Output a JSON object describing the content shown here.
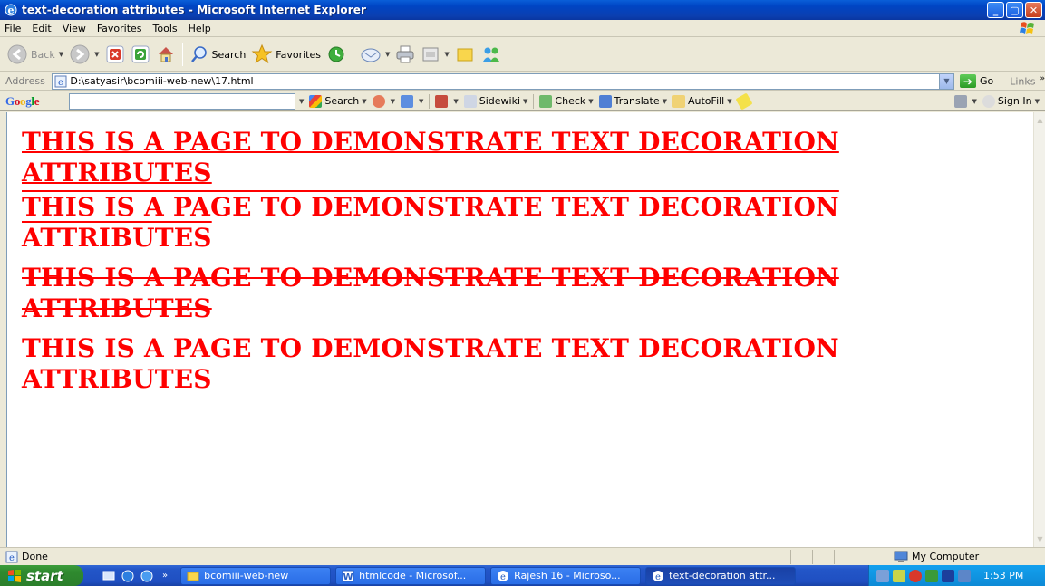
{
  "window": {
    "title": "text-decoration attributes - Microsoft Internet Explorer",
    "buttons": {
      "minimize": "_",
      "maximize": "▢",
      "close": "✕"
    }
  },
  "menu": [
    "File",
    "Edit",
    "View",
    "Favorites",
    "Tools",
    "Help"
  ],
  "toolbar": {
    "back": "Back",
    "search": "Search",
    "favorites": "Favorites"
  },
  "address": {
    "label": "Address",
    "value": "D:\\satyasir\\bcomiii-web-new\\17.html",
    "go": "Go",
    "links": "Links"
  },
  "google": {
    "logo": "Google",
    "search_value": "",
    "items": {
      "search": "Search",
      "sidewiki": "Sidewiki",
      "check": "Check",
      "translate": "Translate",
      "autofill": "AutoFill",
      "sign_in": "Sign In"
    }
  },
  "content": {
    "headings": [
      {
        "text": "THIS IS A PAGE TO DEMONSTRATE TEXT DECORATION ATTRIBUTES",
        "decoration": "underline"
      },
      {
        "text": "THIS IS A PAGE TO DEMONSTRATE TEXT DECORATION ATTRIBUTES",
        "decoration": "overline"
      },
      {
        "text": "THIS IS A PAGE TO DEMONSTRATE TEXT DECORATION ATTRIBUTES",
        "decoration": "line-through"
      },
      {
        "text": "THIS IS A PAGE TO DEMONSTRATE TEXT DECORATION ATTRIBUTES",
        "decoration": "none"
      }
    ],
    "heading_color": "#ff0000"
  },
  "status": {
    "text": "Done",
    "zone": "My Computer"
  },
  "taskbar": {
    "start": "start",
    "tasks": [
      {
        "label": "bcomiii-web-new",
        "icon": "folder-icon"
      },
      {
        "label": "htmlcode - Microsof...",
        "icon": "word-icon"
      },
      {
        "label": "Rajesh 16 - Microso...",
        "icon": "ie-icon"
      },
      {
        "label": "text-decoration attr...",
        "icon": "ie-icon",
        "active": true
      }
    ],
    "clock": "1:53 PM"
  }
}
